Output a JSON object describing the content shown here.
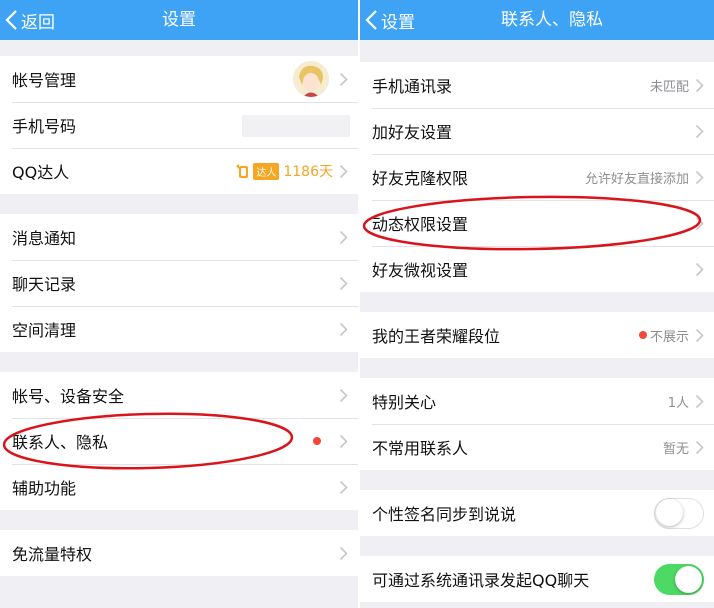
{
  "colors": {
    "nav_bar": "#3fa3f5",
    "accent_orange": "#f5a623",
    "red_dot": "#f4473a",
    "toggle_on": "#4cd964",
    "annotation_red": "#d9141b"
  },
  "left": {
    "back_label": "返回",
    "title": "设置",
    "items": [
      {
        "label": "帐号管理"
      },
      {
        "label": "手机号码"
      },
      {
        "label": "QQ达人",
        "badge": "达人",
        "days": "1186天"
      },
      {
        "label": "消息通知"
      },
      {
        "label": "聊天记录"
      },
      {
        "label": "空间清理"
      },
      {
        "label": "帐号、设备安全"
      },
      {
        "label": "联系人、隐私"
      },
      {
        "label": "辅助功能"
      },
      {
        "label": "免流量特权"
      }
    ]
  },
  "right": {
    "back_label": "设置",
    "title": "联系人、隐私",
    "items": [
      {
        "label": "手机通讯录",
        "value": "未匹配"
      },
      {
        "label": "加好友设置"
      },
      {
        "label": "好友克隆权限",
        "value": "允许好友直接添加"
      },
      {
        "label": "动态权限设置"
      },
      {
        "label": "好友微视设置"
      },
      {
        "label": "我的王者荣耀段位",
        "value": "不展示"
      },
      {
        "label": "特别关心",
        "value": "1人"
      },
      {
        "label": "不常用联系人",
        "value": "暂无"
      },
      {
        "label": "个性签名同步到说说",
        "toggle": "off"
      },
      {
        "label": "可通过系统通讯录发起QQ聊天",
        "toggle": "on"
      }
    ]
  }
}
